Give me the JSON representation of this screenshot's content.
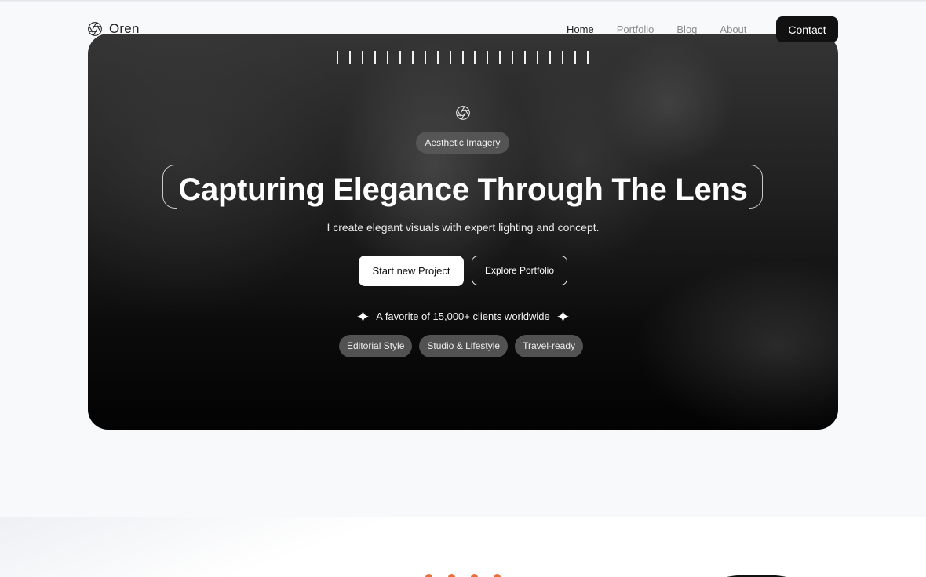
{
  "brand": {
    "name": "Oren",
    "logo_icon": "aperture-icon"
  },
  "nav": {
    "links": [
      {
        "label": "Home",
        "active": true
      },
      {
        "label": "Portfolio",
        "active": false
      },
      {
        "label": "Blog",
        "active": false
      },
      {
        "label": "About",
        "active": false
      }
    ],
    "contact_label": "Contact"
  },
  "hero": {
    "badge": "Aesthetic Imagery",
    "headline": "Capturing Elegance Through The Lens",
    "subline": "I create elegant visuals with expert lighting and concept.",
    "primary_cta": "Start new Project",
    "secondary_cta": "Explore Portfolio",
    "trust_text": "A favorite of 15,000+ clients worldwide",
    "tags": [
      "Editorial Style",
      "Studio & Lifestyle",
      "Travel-ready"
    ]
  },
  "colors": {
    "accent_dark": "#111111",
    "page_bg": "#f8f9fb",
    "dot_accent": "#e8713a"
  }
}
